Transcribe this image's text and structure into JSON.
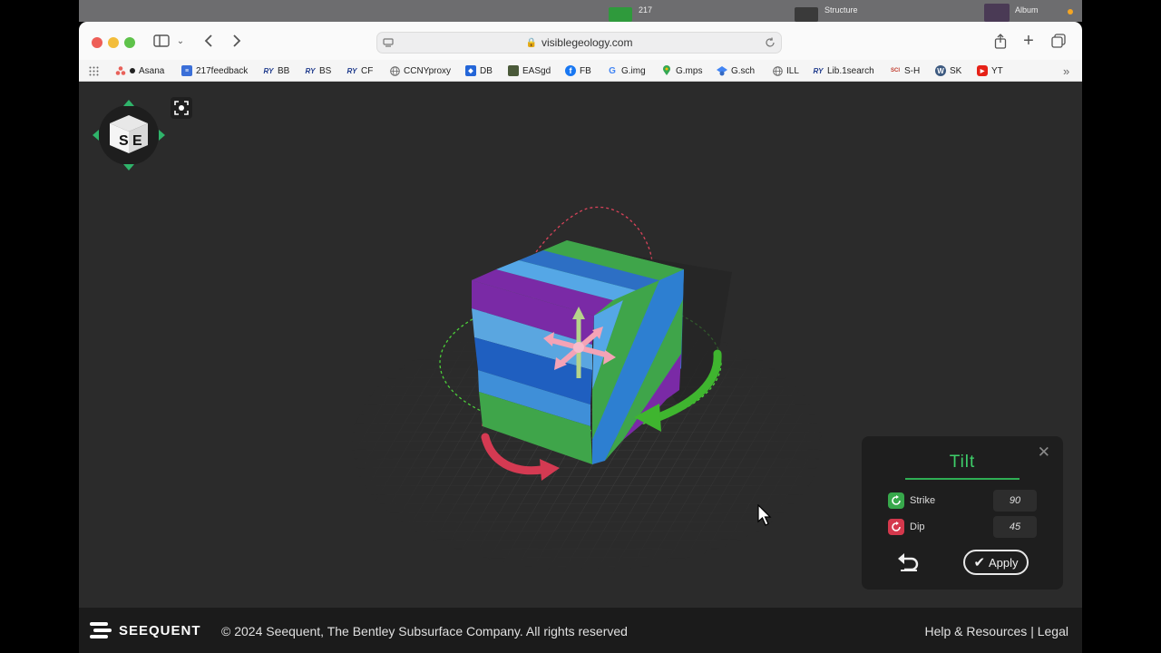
{
  "desktop": {
    "items": [
      {
        "label": "217"
      },
      {
        "label": "Structure"
      },
      {
        "label": "Album"
      }
    ]
  },
  "browser": {
    "url": "visiblegeology.com",
    "bookmarks": [
      {
        "label": "Asana",
        "icon": "asana-icon"
      },
      {
        "label": "217feedback",
        "icon": "doc-icon"
      },
      {
        "label": "BB",
        "icon": "cuny-icon"
      },
      {
        "label": "BS",
        "icon": "cuny-icon"
      },
      {
        "label": "CF",
        "icon": "cuny-icon"
      },
      {
        "label": "CCNYproxy",
        "icon": "globe-icon"
      },
      {
        "label": "DB",
        "icon": "dropbox-icon"
      },
      {
        "label": "EASgd",
        "icon": "image-icon"
      },
      {
        "label": "FB",
        "icon": "facebook-icon"
      },
      {
        "label": "G.img",
        "icon": "google-icon"
      },
      {
        "label": "G.mps",
        "icon": "maps-icon"
      },
      {
        "label": "G.sch",
        "icon": "scholar-icon"
      },
      {
        "label": "ILL",
        "icon": "globe-icon"
      },
      {
        "label": "Lib.1search",
        "icon": "cuny-icon"
      },
      {
        "label": "S-H",
        "icon": "scihub-icon"
      },
      {
        "label": "SK",
        "icon": "wordpress-icon"
      },
      {
        "label": "YT",
        "icon": "youtube-icon"
      }
    ]
  },
  "viewer": {
    "nav_cube_letters": "SE"
  },
  "tilt": {
    "title": "Tilt",
    "strike_label": "Strike",
    "strike_value": "90",
    "dip_label": "Dip",
    "dip_value": "45",
    "apply_label": "Apply"
  },
  "footer": {
    "logo_text": "SEEQUENT",
    "copyright": "© 2024 Seequent, The Bentley Subsurface Company. All rights reserved",
    "help_link": "Help & Resources",
    "separator": " | ",
    "legal_link": "Legal"
  },
  "colors": {
    "accent_green": "#3ecf6a",
    "strike_green": "#37a84b",
    "dip_red": "#d4384c",
    "layer_purple": "#7a2aa6",
    "layer_blue": "#2d7fd1",
    "layer_light_blue": "#55a7e6",
    "layer_green": "#3fa54a"
  }
}
